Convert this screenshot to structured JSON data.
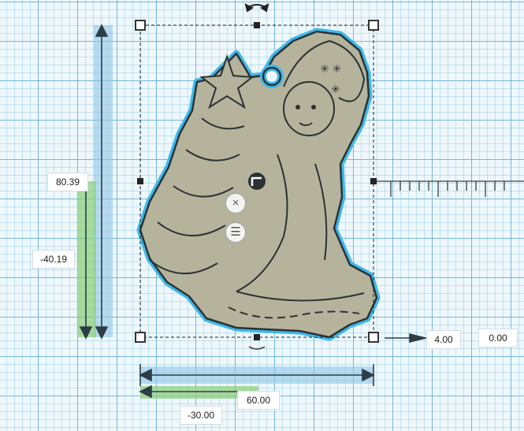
{
  "dimensions": {
    "height": "80.39",
    "elevation": "-40.19",
    "width": "60.00",
    "x_position": "-30.00",
    "z_height": "4.00",
    "z_position": "0.00"
  },
  "controls": {
    "close_glyph": "×",
    "menu_glyph": "☰"
  },
  "colors": {
    "object_fill": "#b5b39b",
    "object_outline": "#2b3235",
    "selection_glow": "#3eb8ea",
    "height_ruler": "#8fc7e8",
    "elevation_ruler": "#8ed07f",
    "width_ruler": "#8fc7e8"
  },
  "icons": [
    "rotate-arrows-icon",
    "close-icon",
    "menu-icon",
    "drag-handle-icon"
  ]
}
